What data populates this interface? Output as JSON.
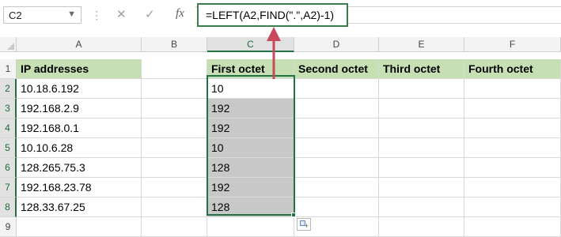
{
  "name_box": {
    "value": "C2"
  },
  "formula_bar": {
    "cancel_icon": "✕",
    "enter_icon": "✓",
    "fx_label": "fx",
    "formula": "=LEFT(A2,FIND(\".\",A2)-1)"
  },
  "columns": [
    "A",
    "B",
    "C",
    "D",
    "E",
    "F"
  ],
  "rows": [
    "1",
    "2",
    "3",
    "4",
    "5",
    "6",
    "7",
    "8",
    "9"
  ],
  "headers": {
    "ip_addresses": "IP addresses",
    "first_octet": "First octet",
    "second_octet": "Second octet",
    "third_octet": "Third octet",
    "fourth_octet": "Fourth octet"
  },
  "ip_addresses": [
    "10.18.6.192",
    "192.168.2.9",
    "192.168.0.1",
    "10.10.6.28",
    "128.265.75.3",
    "192.168.23.78",
    "128.33.67.25"
  ],
  "first_octets": [
    "10",
    "192",
    "192",
    "10",
    "128",
    "192",
    "128"
  ],
  "colors": {
    "header_fill": "#c6e0b4",
    "selection_border": "#217346",
    "selection_fill": "#c8c8c8",
    "arrow": "#c9485b"
  },
  "icons": [
    "name-box-dropdown-icon",
    "cancel-icon",
    "enter-icon",
    "fx-icon",
    "paste-options-icon"
  ]
}
